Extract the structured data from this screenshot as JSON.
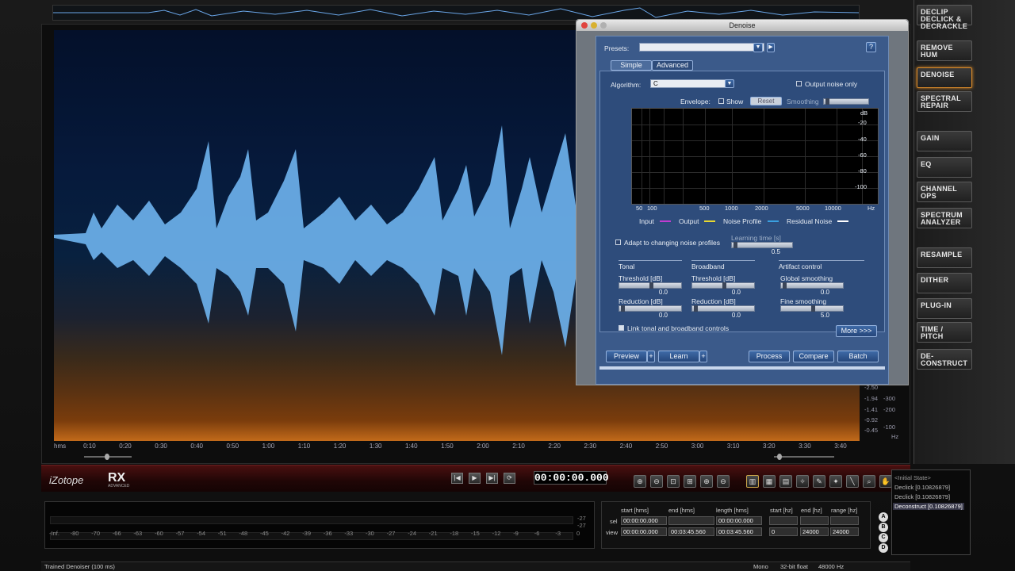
{
  "modules": [
    {
      "l1": "DECLIP",
      "l2": "DECLICK &",
      "l3": "DECRACKLE"
    },
    {
      "l1": "REMOVE",
      "l2": "HUM",
      "l3": ""
    },
    {
      "l1": "DENOISE",
      "l2": "",
      "l3": ""
    },
    {
      "l1": "SPECTRAL",
      "l2": "REPAIR",
      "l3": ""
    },
    {
      "l1": "GAIN",
      "l2": "",
      "l3": ""
    },
    {
      "l1": "EQ",
      "l2": "",
      "l3": ""
    },
    {
      "l1": "CHANNEL",
      "l2": "OPS",
      "l3": ""
    },
    {
      "l1": "SPECTRUM",
      "l2": "ANALYZER",
      "l3": ""
    },
    {
      "l1": "RESAMPLE",
      "l2": "",
      "l3": ""
    },
    {
      "l1": "DITHER",
      "l2": "",
      "l3": ""
    },
    {
      "l1": "PLUG-IN",
      "l2": "",
      "l3": ""
    },
    {
      "l1": "TIME /",
      "l2": "PITCH",
      "l3": ""
    },
    {
      "l1": "DE-",
      "l2": "CONSTRUCT",
      "l3": ""
    }
  ],
  "time_ticks": [
    "hms",
    "0:10",
    "0:20",
    "0:30",
    "0:40",
    "0:50",
    "1:00",
    "1:10",
    "1:20",
    "1:30",
    "1:40",
    "1:50",
    "2:00",
    "2:10",
    "2:20",
    "2:30",
    "2:40",
    "2:50",
    "3:00",
    "3:10",
    "3:20",
    "3:30",
    "3:40"
  ],
  "vaxis": {
    "db": [
      "-2.50",
      "-1.94",
      "-1.41",
      "-0.92",
      "-0.45"
    ],
    "hz": [
      "-300",
      "-200",
      "-100",
      "Hz"
    ]
  },
  "denoise": {
    "title": "Denoise",
    "presets_label": "Presets:",
    "help": "?",
    "tab_simple": "Simple",
    "tab_advanced": "Advanced",
    "algorithm_label": "Algorithm:",
    "algorithm_value": "C",
    "output_noise_only": "Output noise only",
    "envelope_label": "Envelope:",
    "show": "Show",
    "reset": "Reset",
    "smoothing": "Smoothing",
    "db_ticks": [
      "dB",
      "-20",
      "-40",
      "-60",
      "-80",
      "-100"
    ],
    "hz_ticks": [
      "50",
      "100",
      "500",
      "1000",
      "2000",
      "5000",
      "10000",
      "Hz"
    ],
    "legend": {
      "input": "Input",
      "output": "Output",
      "noise_profile": "Noise Profile",
      "residual": "Residual Noise",
      "input_color": "#c03cd0",
      "output_color": "#e8d830",
      "noise_color": "#3aa0e0",
      "residual_color": "#ffffff"
    },
    "adapt": "Adapt to changing noise profiles",
    "learning_time": "Learning time [s]",
    "learning_value": "0.5",
    "tonal": "Tonal",
    "broadband": "Broadband",
    "artifact": "Artifact control",
    "threshold": "Threshold [dB]",
    "reduction": "Reduction [dB]",
    "global_smoothing": "Global smoothing",
    "fine_smoothing": "Fine smoothing",
    "tonal_threshold": "0.0",
    "tonal_reduction": "0.0",
    "bb_threshold": "0.0",
    "bb_reduction": "0.0",
    "global_value": "0.0",
    "fine_value": "5.0",
    "link": "Link tonal and broadband controls",
    "more": "More >>>",
    "preview": "Preview",
    "learn": "Learn",
    "process": "Process",
    "compare": "Compare",
    "batch": "Batch",
    "plus": "+"
  },
  "transport": {
    "timecode": "00:00:00.000",
    "logo": "iZotope",
    "rx": "RX",
    "advanced": "ADVANCED"
  },
  "meter_ticks": [
    "-Inf.",
    "-80",
    "-70",
    "-66",
    "-63",
    "-60",
    "-57",
    "-54",
    "-51",
    "-48",
    "-45",
    "-42",
    "-39",
    "-36",
    "-33",
    "-30",
    "-27",
    "-24",
    "-21",
    "-18",
    "-15",
    "-12",
    "-9",
    "-6",
    "-3",
    "0"
  ],
  "meter_right": [
    "-27",
    "-27"
  ],
  "selection": {
    "headers": [
      "start [hms]",
      "end [hms]",
      "length [hms]",
      "start [hz]",
      "end [hz]",
      "range [hz]"
    ],
    "sel_label": "sel",
    "view_label": "view",
    "sel": [
      "00:00:00.000",
      "",
      "00:00:00.000",
      "",
      "",
      ""
    ],
    "view": [
      "00:00:00.000",
      "00:03:45.560",
      "00:03:45.560",
      "0",
      "24000",
      "24000"
    ]
  },
  "history": [
    "<Initial State>",
    "Declick [0.10826879]",
    "Declick [0.10826879]",
    "Deconstruct [0.10826879]"
  ],
  "abcd": [
    "A",
    "B",
    "C",
    "D"
  ],
  "status": {
    "left": "Trained Denoiser (100 ms)",
    "mono": "Mono",
    "bit": "32-bit float",
    "rate": "48000 Hz"
  }
}
